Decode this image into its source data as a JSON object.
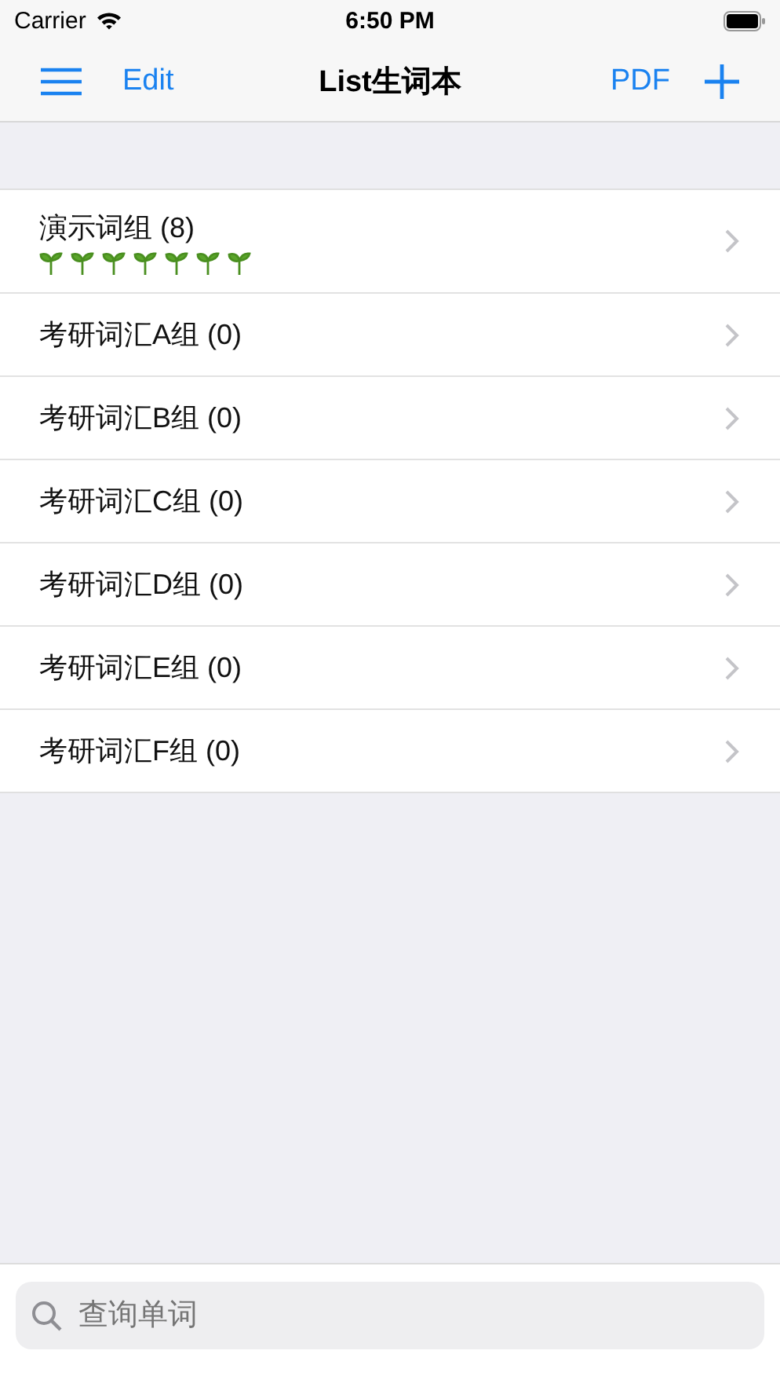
{
  "status_bar": {
    "carrier": "Carrier",
    "time": "6:50 PM"
  },
  "nav": {
    "edit": "Edit",
    "title": "List生词本",
    "pdf": "PDF"
  },
  "groups": [
    {
      "name": "演示词组 (8)",
      "badges": [
        {
          "kind": "sprout"
        },
        {
          "kind": "sprout"
        },
        {
          "kind": "sprout"
        },
        {
          "kind": "sprout"
        },
        {
          "kind": "sprout"
        },
        {
          "kind": "sprout"
        },
        {
          "kind": "sprout"
        }
      ]
    },
    {
      "name": "考研词汇A组 (0)"
    },
    {
      "name": "考研词汇B组 (0)"
    },
    {
      "name": "考研词汇C组 (0)"
    },
    {
      "name": "考研词汇D组 (0)"
    },
    {
      "name": "考研词汇E组 (0)"
    },
    {
      "name": "考研词汇F组 (0)"
    }
  ],
  "search": {
    "placeholder": "查询单词"
  }
}
